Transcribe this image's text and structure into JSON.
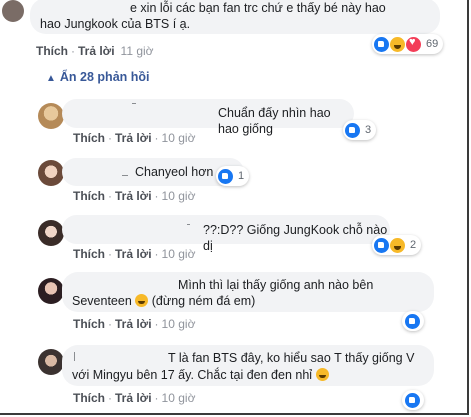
{
  "top_comment": {
    "text_line1": "e xin lỗi các bạn fan trc chứ e thấy bé này hao",
    "text_line2": "hao Jungkook của BTS í ạ.",
    "like": "Thích",
    "reply": "Trả lời",
    "time": "11 giờ",
    "reaction_count": "69"
  },
  "hidden_replies": {
    "label": "Ẩn 28 phản hồi"
  },
  "replies": [
    {
      "text": "Chuẩn đấy nhìn hao hao giống",
      "like": "Thích",
      "reply": "Trả lời",
      "time": "10 giờ",
      "reaction_count": "3"
    },
    {
      "text": "Chanyeol hơn",
      "like": "Thích",
      "reply": "Trả lời",
      "time": "10 giờ",
      "reaction_count": "1"
    },
    {
      "text": "??:D?? Giống JungKook chỗ nào dị",
      "like": "Thích",
      "reply": "Trả lời",
      "time": "10 giờ",
      "reaction_count": "2"
    },
    {
      "text_line1": "Mình thì lại thấy giống anh nào bên",
      "text_line2": "Seventeen",
      "text_line2_suffix": "(đừng ném đá em)",
      "like": "Thích",
      "reply": "Trả lời",
      "time": "10 giờ"
    },
    {
      "text_line1": "T là fan BTS đây, ko hiểu sao T thấy giống V",
      "text_line2": "với Mingyu bên 17 ấy. Chắc tại đen đen nhỉ",
      "like": "Thích",
      "reply": "Trả lời",
      "time": "10 giờ"
    }
  ],
  "colors": {
    "link": "#385898",
    "bubble": "#f2f3f5",
    "like_blue": "#1877f2"
  }
}
